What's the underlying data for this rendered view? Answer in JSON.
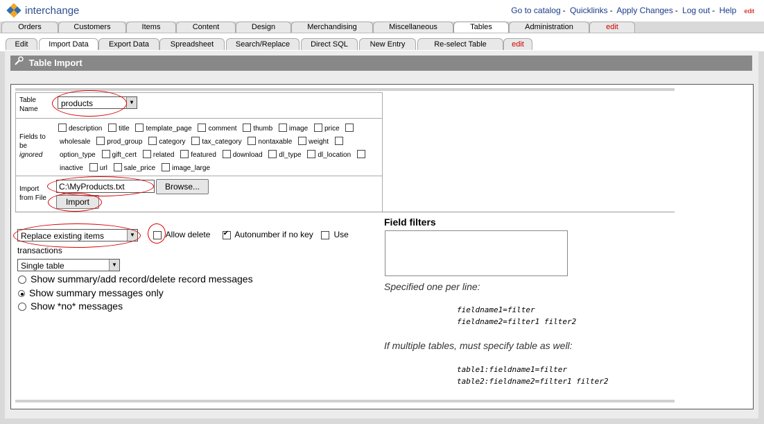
{
  "app": {
    "name": "interchange"
  },
  "toplinks": {
    "catalog": "Go to catalog",
    "quicklinks": "Quicklinks",
    "apply": "Apply Changes",
    "logout": "Log out",
    "help": "Help",
    "edit": "edit"
  },
  "main_tabs": [
    "Orders",
    "Customers",
    "Items",
    "Content",
    "Design",
    "Merchandising",
    "Miscellaneous",
    "Tables",
    "Administration",
    "edit"
  ],
  "sub_tabs": [
    "Edit",
    "Import Data",
    "Export Data",
    "Spreadsheet",
    "Search/Replace",
    "Direct SQL",
    "New Entry",
    "Re-select Table",
    "edit"
  ],
  "page": {
    "title": "Table Import"
  },
  "form": {
    "table_name_label_1": "Table",
    "table_name_label_2": "Name",
    "table_name_value": "products",
    "ignored_label_1": "Fields to",
    "ignored_label_2": "be",
    "ignored_label_3": "ignored",
    "fields": [
      [
        "description",
        "title",
        "template_page",
        "comment",
        "thumb",
        "image",
        "price"
      ],
      [
        "wholesale",
        "prod_group",
        "category",
        "tax_category",
        "nontaxable",
        "weight"
      ],
      [
        "option_type",
        "gift_cert",
        "related",
        "featured",
        "download",
        "dl_type",
        "dl_location"
      ],
      [
        "inactive",
        "url",
        "sale_price",
        "image_large"
      ]
    ],
    "import_label_1": "Import",
    "import_label_2": "from File",
    "file_value": "C:\\MyProducts.txt",
    "browse_label": "Browse...",
    "import_label": "Import",
    "mode_value": "Replace existing items",
    "allow_delete": "Allow delete",
    "autonumber": "Autonumber if no key",
    "use_label": "Use",
    "transactions": "transactions",
    "table_mode_value": "Single table",
    "radio_options": [
      "Show summary/add record/delete record messages",
      "Show summary messages only",
      "Show *no* messages"
    ],
    "radio_selected": "Show summary messages only"
  },
  "filters": {
    "title": "Field filters",
    "hint1": "Specified one per line:",
    "ex1a": "fieldname1=filter",
    "ex1b": "fieldname2=filter1 filter2",
    "hint2": "If multiple tables, must specify table as well:",
    "ex2a": "table1:fieldname1=filter",
    "ex2b": "table2:fieldname2=filter1 filter2"
  },
  "colors": {
    "title_bar": "#888888",
    "annotation": "#dd0000",
    "link": "#1a3a8a"
  }
}
